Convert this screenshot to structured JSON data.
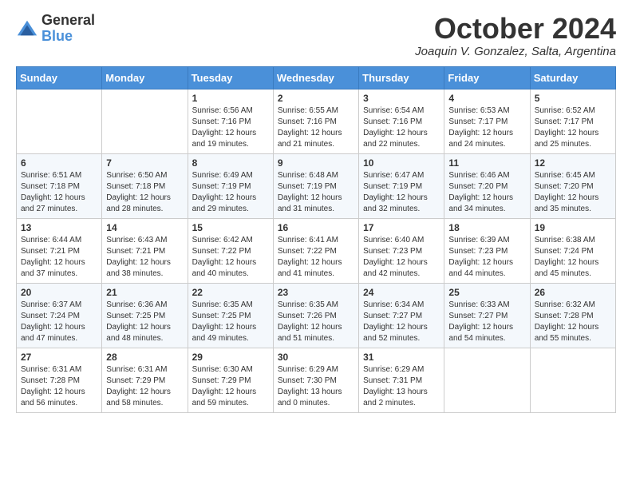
{
  "logo": {
    "general": "General",
    "blue": "Blue"
  },
  "header": {
    "month": "October 2024",
    "location": "Joaquin V. Gonzalez, Salta, Argentina"
  },
  "weekdays": [
    "Sunday",
    "Monday",
    "Tuesday",
    "Wednesday",
    "Thursday",
    "Friday",
    "Saturday"
  ],
  "weeks": [
    [
      {
        "day": "",
        "info": ""
      },
      {
        "day": "",
        "info": ""
      },
      {
        "day": "1",
        "info": "Sunrise: 6:56 AM\nSunset: 7:16 PM\nDaylight: 12 hours and 19 minutes."
      },
      {
        "day": "2",
        "info": "Sunrise: 6:55 AM\nSunset: 7:16 PM\nDaylight: 12 hours and 21 minutes."
      },
      {
        "day": "3",
        "info": "Sunrise: 6:54 AM\nSunset: 7:16 PM\nDaylight: 12 hours and 22 minutes."
      },
      {
        "day": "4",
        "info": "Sunrise: 6:53 AM\nSunset: 7:17 PM\nDaylight: 12 hours and 24 minutes."
      },
      {
        "day": "5",
        "info": "Sunrise: 6:52 AM\nSunset: 7:17 PM\nDaylight: 12 hours and 25 minutes."
      }
    ],
    [
      {
        "day": "6",
        "info": "Sunrise: 6:51 AM\nSunset: 7:18 PM\nDaylight: 12 hours and 27 minutes."
      },
      {
        "day": "7",
        "info": "Sunrise: 6:50 AM\nSunset: 7:18 PM\nDaylight: 12 hours and 28 minutes."
      },
      {
        "day": "8",
        "info": "Sunrise: 6:49 AM\nSunset: 7:19 PM\nDaylight: 12 hours and 29 minutes."
      },
      {
        "day": "9",
        "info": "Sunrise: 6:48 AM\nSunset: 7:19 PM\nDaylight: 12 hours and 31 minutes."
      },
      {
        "day": "10",
        "info": "Sunrise: 6:47 AM\nSunset: 7:19 PM\nDaylight: 12 hours and 32 minutes."
      },
      {
        "day": "11",
        "info": "Sunrise: 6:46 AM\nSunset: 7:20 PM\nDaylight: 12 hours and 34 minutes."
      },
      {
        "day": "12",
        "info": "Sunrise: 6:45 AM\nSunset: 7:20 PM\nDaylight: 12 hours and 35 minutes."
      }
    ],
    [
      {
        "day": "13",
        "info": "Sunrise: 6:44 AM\nSunset: 7:21 PM\nDaylight: 12 hours and 37 minutes."
      },
      {
        "day": "14",
        "info": "Sunrise: 6:43 AM\nSunset: 7:21 PM\nDaylight: 12 hours and 38 minutes."
      },
      {
        "day": "15",
        "info": "Sunrise: 6:42 AM\nSunset: 7:22 PM\nDaylight: 12 hours and 40 minutes."
      },
      {
        "day": "16",
        "info": "Sunrise: 6:41 AM\nSunset: 7:22 PM\nDaylight: 12 hours and 41 minutes."
      },
      {
        "day": "17",
        "info": "Sunrise: 6:40 AM\nSunset: 7:23 PM\nDaylight: 12 hours and 42 minutes."
      },
      {
        "day": "18",
        "info": "Sunrise: 6:39 AM\nSunset: 7:23 PM\nDaylight: 12 hours and 44 minutes."
      },
      {
        "day": "19",
        "info": "Sunrise: 6:38 AM\nSunset: 7:24 PM\nDaylight: 12 hours and 45 minutes."
      }
    ],
    [
      {
        "day": "20",
        "info": "Sunrise: 6:37 AM\nSunset: 7:24 PM\nDaylight: 12 hours and 47 minutes."
      },
      {
        "day": "21",
        "info": "Sunrise: 6:36 AM\nSunset: 7:25 PM\nDaylight: 12 hours and 48 minutes."
      },
      {
        "day": "22",
        "info": "Sunrise: 6:35 AM\nSunset: 7:25 PM\nDaylight: 12 hours and 49 minutes."
      },
      {
        "day": "23",
        "info": "Sunrise: 6:35 AM\nSunset: 7:26 PM\nDaylight: 12 hours and 51 minutes."
      },
      {
        "day": "24",
        "info": "Sunrise: 6:34 AM\nSunset: 7:27 PM\nDaylight: 12 hours and 52 minutes."
      },
      {
        "day": "25",
        "info": "Sunrise: 6:33 AM\nSunset: 7:27 PM\nDaylight: 12 hours and 54 minutes."
      },
      {
        "day": "26",
        "info": "Sunrise: 6:32 AM\nSunset: 7:28 PM\nDaylight: 12 hours and 55 minutes."
      }
    ],
    [
      {
        "day": "27",
        "info": "Sunrise: 6:31 AM\nSunset: 7:28 PM\nDaylight: 12 hours and 56 minutes."
      },
      {
        "day": "28",
        "info": "Sunrise: 6:31 AM\nSunset: 7:29 PM\nDaylight: 12 hours and 58 minutes."
      },
      {
        "day": "29",
        "info": "Sunrise: 6:30 AM\nSunset: 7:29 PM\nDaylight: 12 hours and 59 minutes."
      },
      {
        "day": "30",
        "info": "Sunrise: 6:29 AM\nSunset: 7:30 PM\nDaylight: 13 hours and 0 minutes."
      },
      {
        "day": "31",
        "info": "Sunrise: 6:29 AM\nSunset: 7:31 PM\nDaylight: 13 hours and 2 minutes."
      },
      {
        "day": "",
        "info": ""
      },
      {
        "day": "",
        "info": ""
      }
    ]
  ]
}
